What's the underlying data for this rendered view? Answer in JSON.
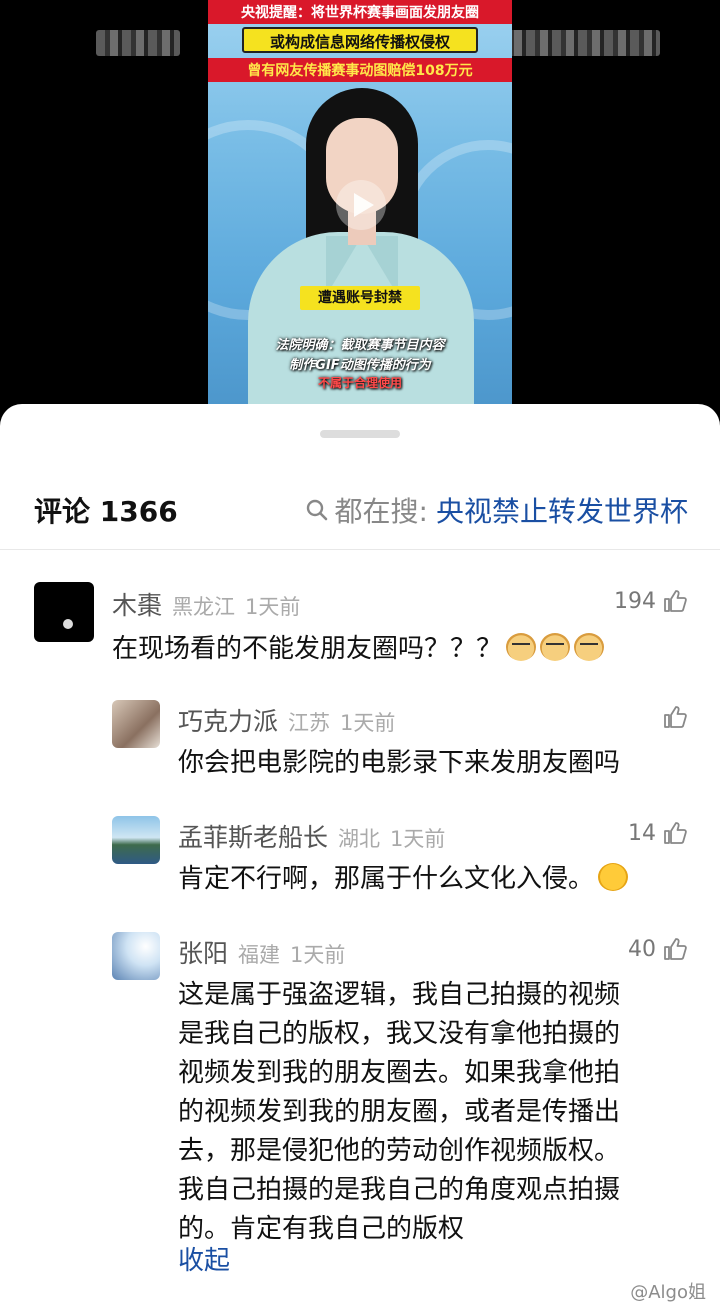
{
  "video": {
    "caption_top": "央视提醒：将世界杯赛事画面发朋友圈",
    "caption_yellow": "或构成信息网络传播权侵权",
    "caption_red": "曾有网友传播赛事动图赔偿108万元",
    "caption_mid": "遭遇账号封禁",
    "caption_law_1": "法院明确：截取赛事节目内容",
    "caption_law_2": "制作GIF动图传播的行为",
    "caption_law_3": "不属于合理使用"
  },
  "header": {
    "title": "评论 1366",
    "search_label": "都在搜:",
    "search_query": "央视禁止转发世界杯"
  },
  "comments": [
    {
      "user": "木棗",
      "location": "黑龙江",
      "time": "1天前",
      "likes": "194",
      "text": "在现场看的不能发朋友圈吗？？？",
      "emoji": [
        "doge-emoji",
        "doge-emoji",
        "doge-emoji"
      ]
    },
    {
      "user": "巧克力派",
      "location": "江苏",
      "time": "1天前",
      "likes": "",
      "text": "你会把电影院的电影录下来发朋友圈吗"
    },
    {
      "user": "孟菲斯老船长",
      "location": "湖北",
      "time": "1天前",
      "likes": "14",
      "text": "肯定不行啊，那属于什么文化入侵。",
      "emoji": [
        "laugh-cry-emoji"
      ]
    },
    {
      "user": "张阳",
      "location": "福建",
      "time": "1天前",
      "likes": "40",
      "lines": [
        "这是属于强盗逻辑，我自己拍摄的视频",
        "是我自己的版权，我又没有拿他拍摄的",
        "视频发到我的朋友圈去。如果我拿他拍",
        "的视频发到我的朋友圈，或者是传播出",
        "去，那是侵犯他的劳动创作视频版权。",
        "我自己拍摄的是我自己的角度观点拍摄",
        "的。肯定有我自己的版权"
      ],
      "collapse": "收起"
    }
  ],
  "watermark": "@Algo姐"
}
